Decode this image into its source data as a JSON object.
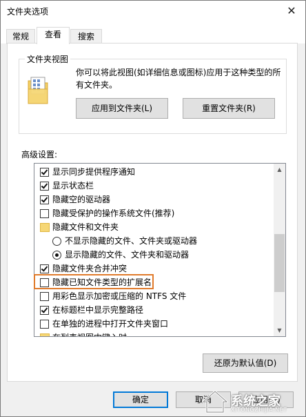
{
  "window": {
    "title": "文件夹选项",
    "close_glyph": "✕"
  },
  "tabs": [
    {
      "label": "常规",
      "active": false
    },
    {
      "label": "查看",
      "active": true
    },
    {
      "label": "搜索",
      "active": false
    }
  ],
  "folder_views": {
    "legend": "文件夹视图",
    "description_line1": "你可以将此视图(如详细信息或图标)应用于这种类型的所",
    "description_line2": "有文件夹。",
    "apply_button": "应用到文件夹(L)",
    "reset_button": "重置文件夹(R)"
  },
  "advanced": {
    "label": "高级设置:",
    "items": [
      {
        "type": "checkbox",
        "checked": true,
        "indent": 0,
        "label": "显示同步提供程序通知"
      },
      {
        "type": "checkbox",
        "checked": true,
        "indent": 0,
        "label": "显示状态栏"
      },
      {
        "type": "checkbox",
        "checked": true,
        "indent": 0,
        "label": "隐藏空的驱动器"
      },
      {
        "type": "checkbox",
        "checked": false,
        "indent": 0,
        "label": "隐藏受保护的操作系统文件(推荐)"
      },
      {
        "type": "folder",
        "indent": 0,
        "label": "隐藏文件和文件夹"
      },
      {
        "type": "radio",
        "checked": false,
        "indent": 1,
        "label": "不显示隐藏的文件、文件夹或驱动器"
      },
      {
        "type": "radio",
        "checked": true,
        "indent": 1,
        "label": "显示隐藏的文件、文件夹和驱动器"
      },
      {
        "type": "checkbox",
        "checked": true,
        "indent": 0,
        "label": "隐藏文件夹合并冲突"
      },
      {
        "type": "checkbox",
        "checked": false,
        "indent": 0,
        "label": "隐藏已知文件类型的扩展名"
      },
      {
        "type": "checkbox",
        "checked": false,
        "indent": 0,
        "label": "用彩色显示加密或压缩的 NTFS 文件"
      },
      {
        "type": "checkbox",
        "checked": true,
        "indent": 0,
        "label": "在标题栏中显示完整路径"
      },
      {
        "type": "checkbox",
        "checked": false,
        "indent": 0,
        "label": "在单独的进程中打开文件夹窗口"
      },
      {
        "type": "folder",
        "indent": 0,
        "label": "在列表视图中键入时"
      }
    ],
    "scroll_up_glyph": "▲",
    "scroll_down_glyph": "▼",
    "restore_button": "还原为默认值(D)"
  },
  "footer": {
    "ok_button": "确定",
    "cancel_button": "取消",
    "apply_button": "应用(A)"
  },
  "watermark": {
    "text": "系统之家",
    "subtext": "XITONGZHIJIA.NET"
  },
  "colors": {
    "highlight": "#e07a2b",
    "default_button_border": "#0078d7"
  }
}
